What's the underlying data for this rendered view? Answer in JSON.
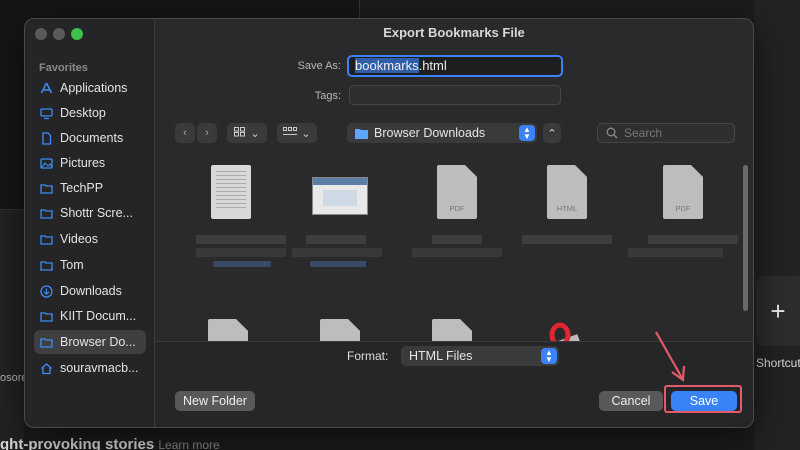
{
  "dialog": {
    "title": "Export Bookmarks File"
  },
  "sidebar": {
    "header": "Favorites",
    "items": [
      {
        "label": "Applications",
        "icon": "applications-icon"
      },
      {
        "label": "Desktop",
        "icon": "desktop-icon"
      },
      {
        "label": "Documents",
        "icon": "document-icon"
      },
      {
        "label": "Pictures",
        "icon": "pictures-icon"
      },
      {
        "label": "TechPP",
        "icon": "folder-icon"
      },
      {
        "label": "Shottr Scre...",
        "icon": "folder-icon"
      },
      {
        "label": "Videos",
        "icon": "folder-icon"
      },
      {
        "label": "Tom",
        "icon": "folder-icon"
      },
      {
        "label": "Downloads",
        "icon": "downloads-icon"
      },
      {
        "label": "KIIT Docum...",
        "icon": "folder-icon"
      },
      {
        "label": "Browser Do...",
        "icon": "folder-icon",
        "selected": true
      },
      {
        "label": "souravmacb...",
        "icon": "home-icon"
      }
    ]
  },
  "form": {
    "save_as_label": "Save As:",
    "save_as_name": "bookmarks",
    "save_as_ext": ".html",
    "tags_label": "Tags:"
  },
  "toolbar": {
    "location": "Browser Downloads",
    "search_placeholder": "Search"
  },
  "files": {
    "pdf_tag": "PDF",
    "html_tag": "HTML"
  },
  "footer": {
    "format_label": "Format:",
    "format_value": "HTML Files",
    "new_folder": "New Folder",
    "cancel": "Cancel",
    "save": "Save"
  },
  "background": {
    "shortcut_label": "Shortcut",
    "plus": "+",
    "left_partial": "osorec",
    "bottom_heading": "ght-provoking stories",
    "bottom_link": "Learn more"
  },
  "colors": {
    "accent": "#3a82f7",
    "annotation": "#e35a6a",
    "folder": "#3b8ef5"
  }
}
